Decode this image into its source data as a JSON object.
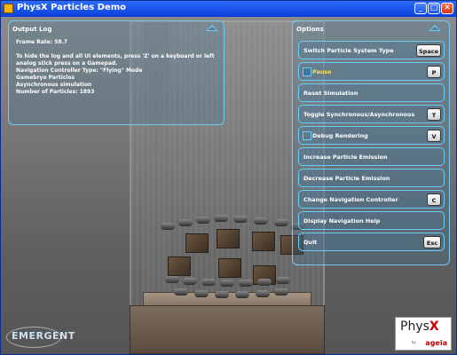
{
  "window": {
    "title": "PhysX Particles Demo",
    "buttons": {
      "minimize": "_",
      "maximize": "□",
      "close": "✕"
    }
  },
  "output_log": {
    "title": "Output Log",
    "lines": [
      "Frame Rate: 58.7",
      "To hide the log and all UI elements, press 'Z' on a keyboard or left",
      "analog stick press on a Gamepad.",
      "Navigation Controller Type: \"Flying\" Mode",
      "Gamebryo Particles",
      "Asynchronous simulation",
      "Number of Particles: 1893"
    ]
  },
  "options": {
    "title": "Options",
    "items": [
      {
        "label": "Switch Particle System Type",
        "key": "Space"
      },
      {
        "label": "Pause",
        "key": "P"
      },
      {
        "label": "Reset Simulation",
        "key": ""
      },
      {
        "label": "Toggle Synchronous/Asynchronous",
        "key": "T"
      },
      {
        "label": "Debug Rendering",
        "key": "V"
      },
      {
        "label": "Increase Particle Emission",
        "key": ""
      },
      {
        "label": "Decrease Particle Emission",
        "key": ""
      },
      {
        "label": "Change Navigation Controller",
        "key": "C"
      },
      {
        "label": "Display Navigation Help",
        "key": ""
      },
      {
        "label": "Quit",
        "key": "Esc"
      }
    ]
  },
  "logos": {
    "emergent": "EMERGENT",
    "physx_main": "Phys",
    "physx_x": "X",
    "physx_by": "by",
    "physx_brand": "ageia"
  },
  "colors": {
    "panel_border": "#6ecbf5",
    "pause_text": "#ffe04a",
    "titlebar": "#0a3fd6"
  }
}
